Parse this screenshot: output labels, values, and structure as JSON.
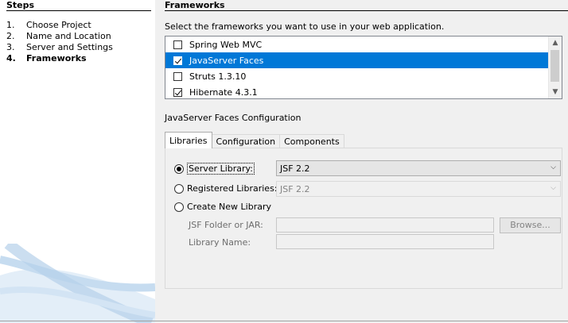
{
  "steps": {
    "title": "Steps",
    "items": [
      {
        "num": "1.",
        "label": "Choose Project"
      },
      {
        "num": "2.",
        "label": "Name and Location"
      },
      {
        "num": "3.",
        "label": "Server and Settings"
      },
      {
        "num": "4.",
        "label": "Frameworks"
      }
    ],
    "current_index": 3
  },
  "main": {
    "title": "Frameworks",
    "instruction": "Select the frameworks you want to use in your web application.",
    "frameworks": [
      {
        "label": "Spring Web MVC",
        "checked": false,
        "selected": false
      },
      {
        "label": "JavaServer Faces",
        "checked": true,
        "selected": true
      },
      {
        "label": "Struts 1.3.10",
        "checked": false,
        "selected": false
      },
      {
        "label": "Hibernate 4.3.1",
        "checked": true,
        "selected": false
      }
    ],
    "config_label": "JavaServer Faces Configuration",
    "tabs": [
      {
        "label": "Libraries",
        "active": true
      },
      {
        "label": "Configuration",
        "active": false
      },
      {
        "label": "Components",
        "active": false
      }
    ],
    "libraries": {
      "server_library_label": "Server Library:",
      "server_library_value": "JSF 2.2",
      "registered_libraries_label": "Registered Libraries:",
      "registered_libraries_value": "JSF 2.2",
      "create_new_label": "Create New Library",
      "jsf_folder_label": "JSF Folder or JAR:",
      "jsf_folder_value": "",
      "library_name_label": "Library Name:",
      "library_name_value": "",
      "browse_label": "Browse...",
      "selected_option": "server_library"
    }
  },
  "colors": {
    "selection": "#0078d7",
    "panel_bg": "#f0f0f0"
  }
}
